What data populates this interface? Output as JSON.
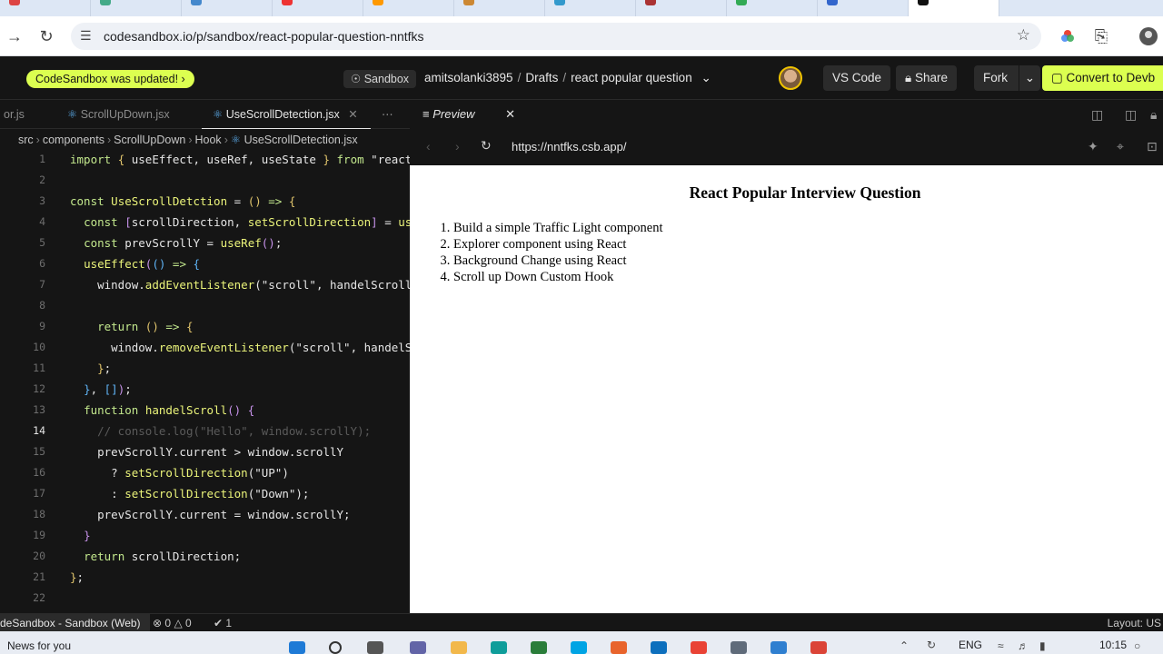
{
  "browser": {
    "url": "codesandbox.io/p/sandbox/react-popular-question-nntfks"
  },
  "header": {
    "updated_label": "CodeSandbox was updated!",
    "sandbox_label": "Sandbox",
    "user": "amitsolanki3895",
    "folder": "Drafts",
    "project": "react popular question",
    "vscode_label": "VS Code",
    "share_label": "Share",
    "fork_label": "Fork",
    "convert_label": "Convert to Devb"
  },
  "editor": {
    "tabs": [
      {
        "label": "or.js"
      },
      {
        "label": "ScrollUpDown.jsx"
      },
      {
        "label": "UseScrollDetection.jsx"
      }
    ],
    "breadcrumb": [
      "src",
      "components",
      "ScrollUpDown",
      "Hook",
      "UseScrollDetection.jsx"
    ],
    "current_line": 14
  },
  "preview": {
    "tab_label": "Preview",
    "url": "https://nntfks.csb.app/",
    "heading": "React Popular Interview Question",
    "items": [
      "Build a simple Traffic Light component",
      "Explorer component using React",
      "Background Change using React",
      "Scroll up Down Custom Hook"
    ]
  },
  "status": {
    "label": "deSandbox - Sandbox (Web)",
    "errors": "0",
    "warnings": "0",
    "ports": "1",
    "layout": "Layout: US"
  },
  "taskbar": {
    "news": "News for you",
    "lang": "ENG",
    "time": "10:15"
  }
}
